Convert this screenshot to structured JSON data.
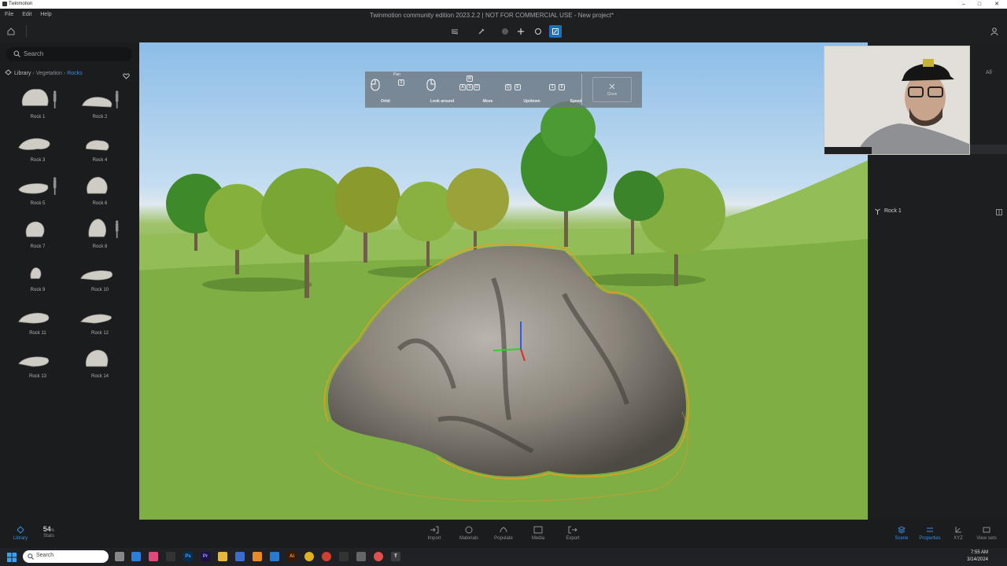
{
  "window": {
    "app_name": "Twinmotion"
  },
  "menu": {
    "file": "File",
    "edit": "Edit",
    "help": "Help"
  },
  "app_title": "Twinmotion community edition 2023.2.2 | NOT FOR COMMERCIAL USE - New project*",
  "search": {
    "placeholder": "Search"
  },
  "breadcrumb": {
    "root": "Library",
    "level1": "Vegetation",
    "current": "Rocks"
  },
  "rocks": [
    "Rock 1",
    "Rock 2",
    "Rock 3",
    "Rock 4",
    "Rock 5",
    "Rock 6",
    "Rock 7",
    "Rock 8",
    "Rock 9",
    "Rock 10",
    "Rock 11",
    "Rock 12",
    "Rock 13",
    "Rock 14"
  ],
  "nav_overlay": {
    "pan": "Pan",
    "orbit": "Orbit",
    "look_around": "Look around",
    "move": "Move",
    "updown": "Up/down",
    "speed": "Speed",
    "close": "Close",
    "keys": {
      "w": "W",
      "a": "A",
      "s": "S",
      "d": "D",
      "q": "Q",
      "e": "E",
      "one": "1",
      "six": "6",
      "zero": "0"
    }
  },
  "right_panel": {
    "filter": "All",
    "scene_item": "Rock 1"
  },
  "bottom_bar": {
    "library": "Library",
    "stats_value": "54",
    "stats_unit": "%",
    "stats": "Stats",
    "import": "Import",
    "materials": "Materials",
    "populate": "Populate",
    "media": "Media",
    "export": "Export",
    "scene": "Scene",
    "properties": "Properties",
    "xyz": "XYZ",
    "view_sets": "View sets"
  },
  "taskbar": {
    "search_placeholder": "Search",
    "time": "7:55 AM",
    "date": "3/14/2024"
  },
  "colors": {
    "accent": "#3b8de0",
    "selection_outline": "#e0a020",
    "panel_bg": "#1b1c1e"
  }
}
